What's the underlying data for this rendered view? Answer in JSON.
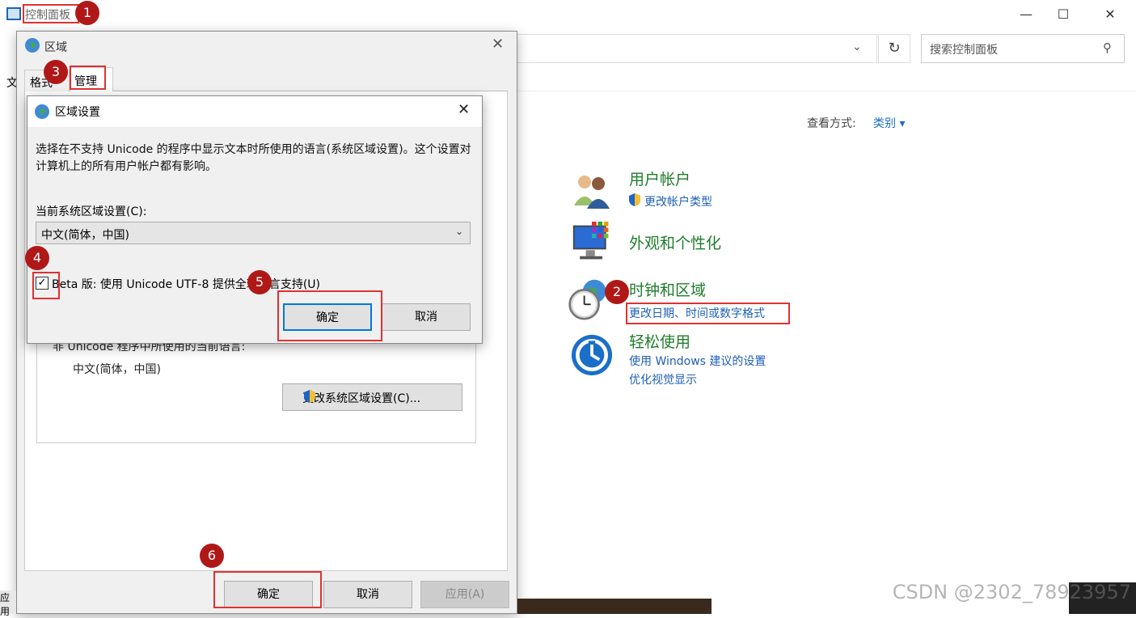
{
  "control_panel": {
    "title": "控制面板",
    "search_placeholder": "搜索控制面板",
    "menu_first": "文",
    "view_by_label": "查看方式:",
    "view_by_value": "类别",
    "categories": [
      {
        "title": "用户帐户",
        "links": [
          "更改帐户类型"
        ]
      },
      {
        "title": "外观和个性化",
        "links": []
      },
      {
        "title": "时钟和区域",
        "links": [
          "更改日期、时间或数字格式"
        ]
      },
      {
        "title": "轻松使用",
        "links": [
          "使用 Windows 建议的设置",
          "优化视觉显示"
        ]
      }
    ]
  },
  "region_dialog": {
    "title": "区域",
    "tabs": [
      "格式",
      "管理"
    ],
    "nonunicode_label": "非 Unicode 程序中所使用的当前语言:",
    "nonunicode_value": "中文(简体，中国)",
    "change_locale_button": "更改系统区域设置(C)...",
    "ok": "确定",
    "cancel": "取消",
    "apply": "应用(A)"
  },
  "region_settings_dialog": {
    "title": "区域设置",
    "description": "选择在不支持 Unicode 的程序中显示文本时所使用的语言(系统区域设置)。这个设置对计算机上的所有用户帐户都有影响。",
    "current_label": "当前系统区域设置(C):",
    "current_value": "中文(简体，中国)",
    "beta_checkbox_label": "Beta 版: 使用 Unicode UTF-8 提供全球语言支持(U)",
    "beta_checked": true,
    "ok": "确定",
    "cancel": "取消"
  },
  "annotations": {
    "step1": "1",
    "step2": "2",
    "step3": "3",
    "step4": "4",
    "step5": "5",
    "step6": "6",
    "color": "#e03131"
  },
  "taskbar_fragment": "应用",
  "watermark": "CSDN @2302_78923957"
}
